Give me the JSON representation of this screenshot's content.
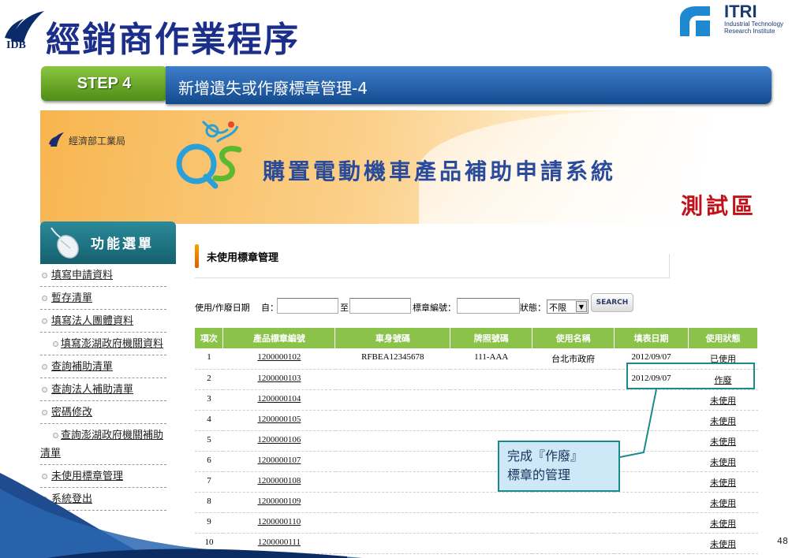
{
  "slide": {
    "title": "經銷商作業程序",
    "idb_label": "IDB",
    "itri": {
      "name": "ITRI",
      "line1": "Industrial Technology",
      "line2": "Research Institute"
    },
    "step_label": "STEP 4",
    "step_title": "新增遺失或作廢標章管理-4",
    "page_number": "48",
    "callout": {
      "line1": "完成『作廢』",
      "line2": "標章的管理"
    }
  },
  "banner": {
    "bureau_name": "經濟部工業局",
    "system_name": "購置電動機車產品補助申請系統",
    "test_zone": "測試區"
  },
  "sidebar": {
    "title": "功能選單",
    "items": [
      {
        "label": "填寫申請資料"
      },
      {
        "label": "暫存清單"
      },
      {
        "label": "填寫法人團體資料"
      },
      {
        "label": "填寫澎湖政府機關資料"
      },
      {
        "label": "查詢補助清單"
      },
      {
        "label": "查詢法人補助清單"
      },
      {
        "label": "密碼修改"
      },
      {
        "label": "查詢澎湖政府機關補助清單"
      },
      {
        "label": "未使用標章管理"
      },
      {
        "label": "系統登出"
      }
    ]
  },
  "panel": {
    "title": "未使用標章管理",
    "filter": {
      "date_label": "使用/作廢日期",
      "from_label": "自：",
      "to_label": "至",
      "from_value": "",
      "to_value": "",
      "label_no_label": "標章編號：",
      "label_no_value": "",
      "status_label": "狀態：",
      "status_value": "不限",
      "search_button": "SEARCH"
    },
    "table": {
      "headers": [
        "項次",
        "產品標章編號",
        "車身號碼",
        "牌照號碼",
        "使用名稱",
        "填表日期",
        "使用狀態"
      ],
      "rows": [
        [
          "1",
          "1200000102",
          "RFBEA12345678",
          "111-AAA",
          "台北市政府",
          "2012/09/07",
          "已使用"
        ],
        [
          "2",
          "1200000103",
          "",
          "",
          "",
          "2012/09/07",
          "作廢"
        ],
        [
          "3",
          "1200000104",
          "",
          "",
          "",
          "",
          "未使用"
        ],
        [
          "4",
          "1200000105",
          "",
          "",
          "",
          "",
          "未使用"
        ],
        [
          "5",
          "1200000106",
          "",
          "",
          "",
          "",
          "未使用"
        ],
        [
          "6",
          "1200000107",
          "",
          "",
          "",
          "",
          "未使用"
        ],
        [
          "7",
          "1200000108",
          "",
          "",
          "",
          "",
          "未使用"
        ],
        [
          "8",
          "1200000109",
          "",
          "",
          "",
          "",
          "未使用"
        ],
        [
          "9",
          "1200000110",
          "",
          "",
          "",
          "",
          "未使用"
        ],
        [
          "10",
          "1200000111",
          "",
          "",
          "",
          "",
          "未使用"
        ]
      ]
    }
  },
  "colors": {
    "title_blue": "#1b2f8a",
    "step_green": "#6aa72a",
    "step_blue": "#1f5ba8",
    "table_header": "#8bc34a",
    "callout_fill": "#cfe8f7",
    "callout_border": "#1a8a8a",
    "test_zone_red": "#c0121b"
  },
  "icons": {
    "idb": "idb-logo-icon",
    "itri": "itri-logo-icon",
    "bureau": "bureau-logo-icon",
    "qs": "qs-logo-icon",
    "mouse": "mouse-icon",
    "bullet": "bullet-icon",
    "dropdown": "dropdown-arrow-icon"
  }
}
